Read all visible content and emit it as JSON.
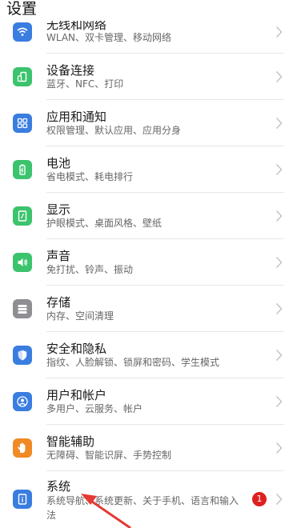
{
  "header": {
    "title": "设置"
  },
  "colors": {
    "blue": "#3a7de0",
    "green": "#3cc36d",
    "orange": "#f08a24",
    "gray": "#8e8e93",
    "badge": "#e02020"
  },
  "items": [
    {
      "title": "无线和网络",
      "subtitle": "WLAN、双卡管理、移动网络",
      "icon": "wifi-icon",
      "color": "#3a7de0"
    },
    {
      "title": "设备连接",
      "subtitle": "蓝牙、NFC、打印",
      "icon": "device-connect-icon",
      "color": "#3cc36d"
    },
    {
      "title": "应用和通知",
      "subtitle": "权限管理、默认应用、应用分身",
      "icon": "apps-grid-icon",
      "color": "#3a7de0"
    },
    {
      "title": "电池",
      "subtitle": "省电模式、耗电排行",
      "icon": "battery-icon",
      "color": "#3cc36d"
    },
    {
      "title": "显示",
      "subtitle": "护眼模式、桌面风格、壁纸",
      "icon": "display-icon",
      "color": "#3cc36d"
    },
    {
      "title": "声音",
      "subtitle": "免打扰、铃声、振动",
      "icon": "speaker-icon",
      "color": "#3cc36d"
    },
    {
      "title": "存储",
      "subtitle": "内存、空间清理",
      "icon": "storage-icon",
      "color": "#8e8e93"
    },
    {
      "title": "安全和隐私",
      "subtitle": "指纹、人脸解锁、锁屏和密码、学生模式",
      "icon": "shield-icon",
      "color": "#3a7de0"
    },
    {
      "title": "用户和帐户",
      "subtitle": "多用户、云服务、帐户",
      "icon": "user-icon",
      "color": "#3a7de0"
    },
    {
      "title": "智能辅助",
      "subtitle": "无障碍、智能识屏、手势控制",
      "icon": "hand-icon",
      "color": "#f08a24"
    },
    {
      "title": "系统",
      "subtitle": "系统导航、系统更新、关于手机、语言和输入法",
      "icon": "system-info-icon",
      "color": "#3a7de0",
      "badge": "1"
    }
  ]
}
